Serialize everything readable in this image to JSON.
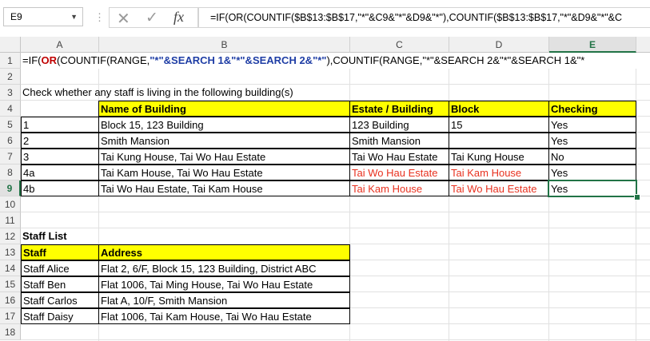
{
  "namebox": {
    "value": "E9"
  },
  "formula_bar": {
    "text": "=IF(OR(COUNTIF($B$13:$B$17,\"*\"&C9&\"*\"&D9&\"*\"),COUNTIF($B$13:$B$17,\"*\"&D9&\"*\"&C"
  },
  "columns": [
    "A",
    "B",
    "C",
    "D",
    "E"
  ],
  "rows": [
    "1",
    "2",
    "3",
    "4",
    "5",
    "6",
    "7",
    "8",
    "9",
    "10",
    "11",
    "12",
    "13",
    "14",
    "15",
    "16",
    "17",
    "18"
  ],
  "row1": {
    "p1": "=IF(",
    "p2": "OR",
    "p3": "(COUNTIF(RANGE,",
    "p4": "\"*\"&SEARCH 1&\"*\"&SEARCH 2&\"*\"",
    "p5": "),COUNTIF(RANGE,\"*\"&SEARCH 2&\"*\"&SEARCH 1&\"*"
  },
  "row3": "Check whether any staff is living in the following building(s)",
  "table1": {
    "headers": [
      "",
      "Name of Building",
      "Estate / Building",
      "Block",
      "Checking"
    ],
    "rows": [
      [
        "1",
        "Block 15, 123 Building",
        "123 Building",
        "15",
        "Yes"
      ],
      [
        "2",
        "Smith Mansion",
        "Smith Mansion",
        "",
        "Yes"
      ],
      [
        "3",
        "Tai Kung House, Tai Wo Hau Estate",
        "Tai Wo Hau Estate",
        "Tai Kung House",
        "No"
      ],
      [
        "4a",
        "Tai Kam House, Tai Wo Hau Estate",
        "Tai Wo Hau Estate",
        "Tai Kam House",
        "Yes"
      ],
      [
        "4b",
        "Tai Wo Hau Estate, Tai Kam House",
        "Tai Kam House",
        "Tai Wo Hau Estate",
        "Yes"
      ]
    ]
  },
  "staff_list_title": "Staff List",
  "table2": {
    "headers": [
      "Staff",
      "Address"
    ],
    "rows": [
      [
        "Staff Alice",
        "Flat 2, 6/F, Block 15, 123 Building, District ABC"
      ],
      [
        "Staff Ben",
        "Flat 1006, Tai Ming House, Tai Wo Hau Estate"
      ],
      [
        "Staff Carlos",
        "Flat A, 10/F, Smith Mansion"
      ],
      [
        "Staff Daisy",
        "Flat 1006, Tai Kam House, Tai Wo Hau Estate"
      ]
    ]
  },
  "colors": {
    "header_fill": "#ffff00",
    "selection": "#217346",
    "red_text": "#e8311f"
  }
}
